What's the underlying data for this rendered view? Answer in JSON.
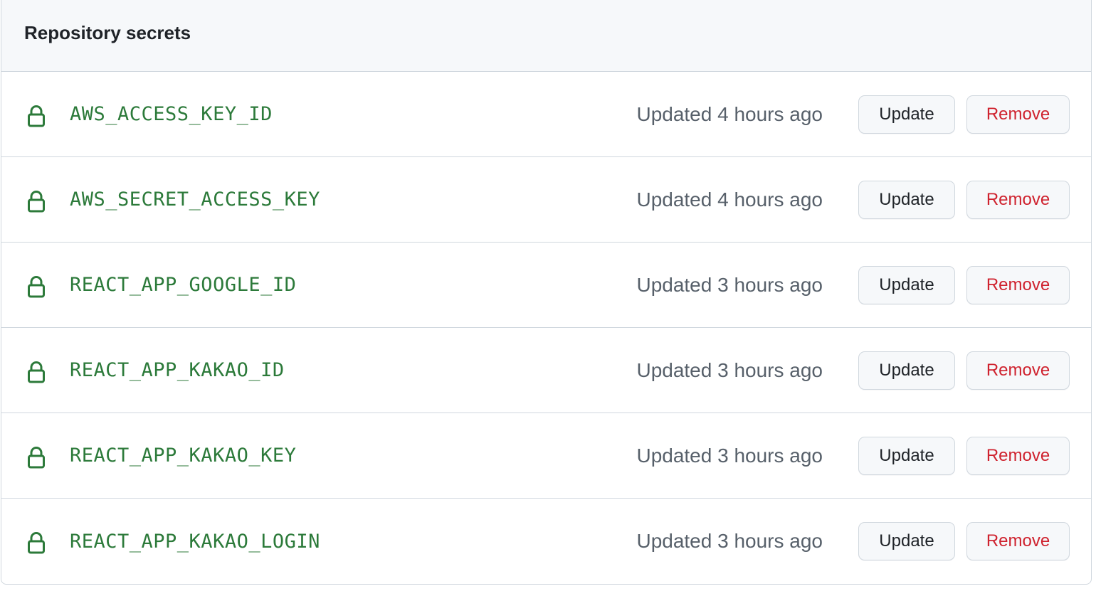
{
  "section": {
    "title": "Repository secrets"
  },
  "secrets": [
    {
      "name": "AWS_ACCESS_KEY_ID",
      "updated": "Updated 4 hours ago",
      "update_label": "Update",
      "remove_label": "Remove"
    },
    {
      "name": "AWS_SECRET_ACCESS_KEY",
      "updated": "Updated 4 hours ago",
      "update_label": "Update",
      "remove_label": "Remove"
    },
    {
      "name": "REACT_APP_GOOGLE_ID",
      "updated": "Updated 3 hours ago",
      "update_label": "Update",
      "remove_label": "Remove"
    },
    {
      "name": "REACT_APP_KAKAO_ID",
      "updated": "Updated 3 hours ago",
      "update_label": "Update",
      "remove_label": "Remove"
    },
    {
      "name": "REACT_APP_KAKAO_KEY",
      "updated": "Updated 3 hours ago",
      "update_label": "Update",
      "remove_label": "Remove"
    },
    {
      "name": "REACT_APP_KAKAO_LOGIN",
      "updated": "Updated 3 hours ago",
      "update_label": "Update",
      "remove_label": "Remove"
    }
  ],
  "icons": {
    "secret": "lock-icon"
  },
  "colors": {
    "secret_name": "#2c7a3a",
    "remove": "#cf222e",
    "header_bg": "#f6f8fa",
    "border": "#d0d7de"
  }
}
